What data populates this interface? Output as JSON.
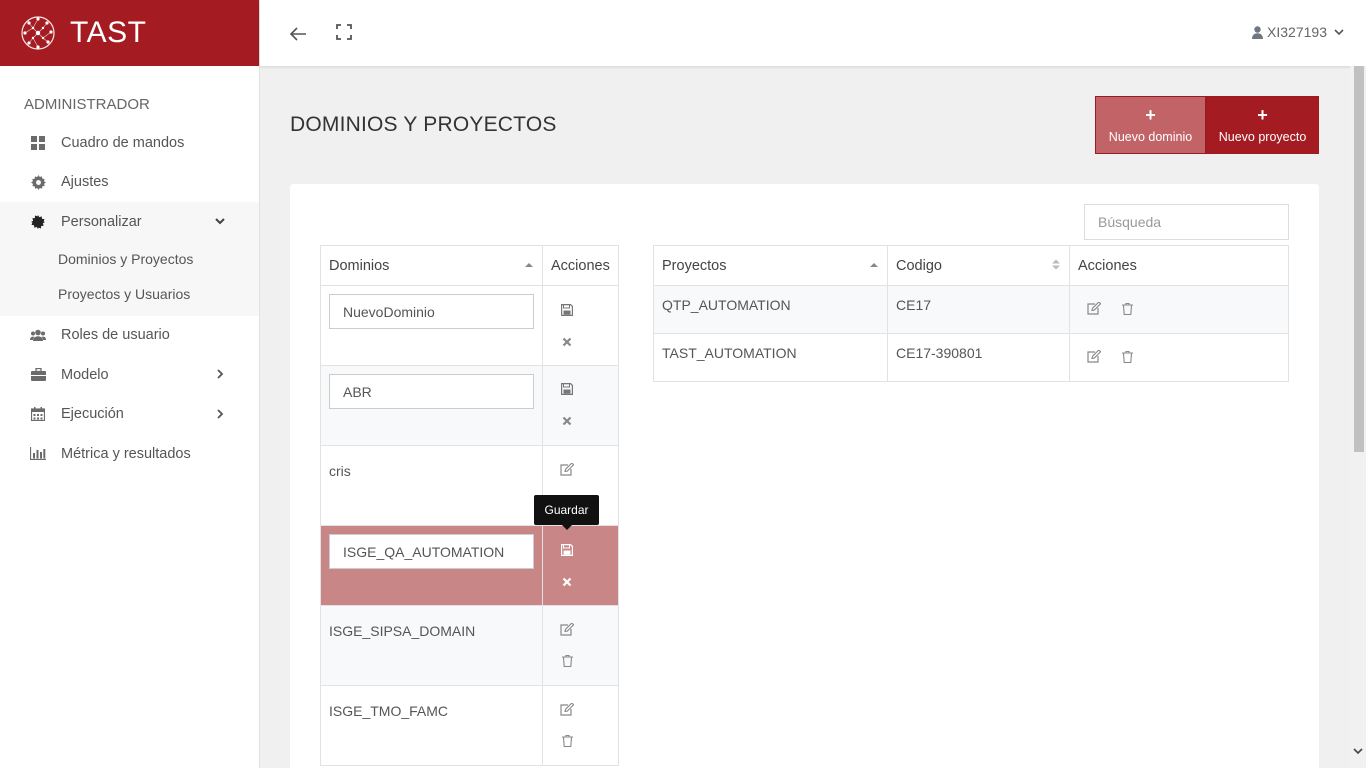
{
  "brand": {
    "name": "TAST"
  },
  "sidebar": {
    "section": "ADMINISTRADOR",
    "items": [
      {
        "label": "Cuadro de mandos",
        "icon": "dashboard-icon"
      },
      {
        "label": "Ajustes",
        "icon": "gear-icon"
      },
      {
        "label": "Personalizar",
        "icon": "puzzle-icon",
        "expanded": true,
        "children": [
          "Dominios y Proyectos",
          "Proyectos y Usuarios"
        ]
      },
      {
        "label": "Roles de usuario",
        "icon": "users-icon"
      },
      {
        "label": "Modelo",
        "icon": "briefcase-icon"
      },
      {
        "label": "Ejecución",
        "icon": "calendar-icon"
      },
      {
        "label": "Métrica y resultados",
        "icon": "bar-chart-icon"
      }
    ]
  },
  "topbar": {
    "user": "XI327193"
  },
  "page": {
    "title": "DOMINIOS Y PROYECTOS",
    "new_domain": "Nuevo dominio",
    "new_project": "Nuevo proyecto",
    "search_placeholder": "Búsqueda"
  },
  "domains": {
    "headers": {
      "name": "Dominios",
      "actions": "Acciones"
    },
    "rows": [
      {
        "value": "NuevoDominio",
        "editing": true
      },
      {
        "value": "ABR",
        "editing": true
      },
      {
        "value": "cris",
        "editing": false
      },
      {
        "value": "ISGE_QA_AUTOMATION",
        "editing": true,
        "selected": true
      },
      {
        "value": "ISGE_SIPSA_DOMAIN",
        "editing": false
      },
      {
        "value": "ISGE_TMO_FAMC",
        "editing": false
      }
    ]
  },
  "projects": {
    "headers": {
      "name": "Proyectos",
      "code": "Codigo",
      "actions": "Acciones"
    },
    "rows": [
      {
        "name": "QTP_AUTOMATION",
        "code": "CE17"
      },
      {
        "name": "TAST_AUTOMATION",
        "code": "CE17-390801"
      }
    ]
  },
  "tooltip": "Guardar",
  "colors": {
    "brand": "#a41c22",
    "selected_row": "#c88686",
    "btn_light": "#c26467"
  }
}
